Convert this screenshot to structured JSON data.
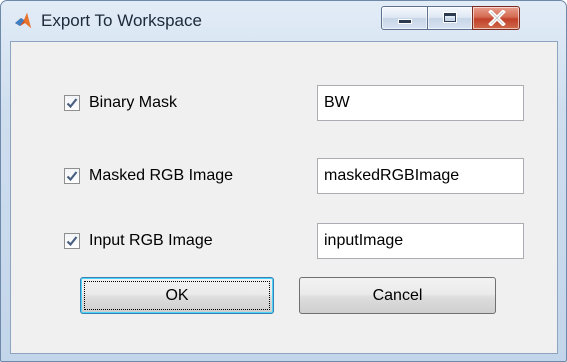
{
  "window": {
    "title": "Export To Workspace",
    "app_icon": "matlab-icon",
    "controls": [
      "minimize-icon",
      "maximize-icon",
      "close-icon"
    ]
  },
  "rows": [
    {
      "label": "Binary Mask",
      "checked": true,
      "value": "BW"
    },
    {
      "label": "Masked RGB Image",
      "checked": true,
      "value": "maskedRGBImage"
    },
    {
      "label": "Input RGB Image",
      "checked": true,
      "value": "inputImage"
    }
  ],
  "buttons": {
    "ok_label": "OK",
    "cancel_label": "Cancel"
  },
  "colors": {
    "titlebar": "#c9daee",
    "dialog_background": "#f0f0f0",
    "close_button": "#c94b33",
    "default_button_border": "#3c7fb1",
    "checkmark": "#4a5f80"
  }
}
